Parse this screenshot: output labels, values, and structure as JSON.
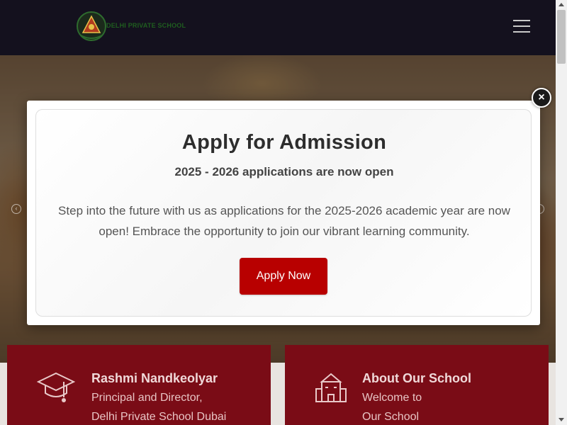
{
  "header": {
    "logo_text": "DELHI PRIVATE SCHOOL",
    "menu_icon": "hamburger-menu-icon"
  },
  "hero": {
    "prev_icon": "chevron-left-icon",
    "next_icon": "chevron-right-icon"
  },
  "modal": {
    "title": "Apply for Admission",
    "subtitle": "2025 - 2026 applications are now open",
    "body": "Step into the future with us as applications for the 2025-2026 academic year are now open! Embrace the opportunity to join our vibrant learning community.",
    "button_label": "Apply Now",
    "close_label": "×",
    "close_icon": "close-icon",
    "button_color": "#b80000"
  },
  "cards": {
    "left": {
      "icon": "graduation-cap-icon",
      "title": "Rashmi Nandkeolyar",
      "line1": "Principal and Director,",
      "line2": "Delhi Private School Dubai"
    },
    "right": {
      "icon": "school-building-icon",
      "title": "About Our School",
      "line1": "Welcome to",
      "line2": "Our School"
    }
  },
  "colors": {
    "header_bg": "#14111e",
    "card_bg": "#7a0c16",
    "accent": "#b80000"
  }
}
